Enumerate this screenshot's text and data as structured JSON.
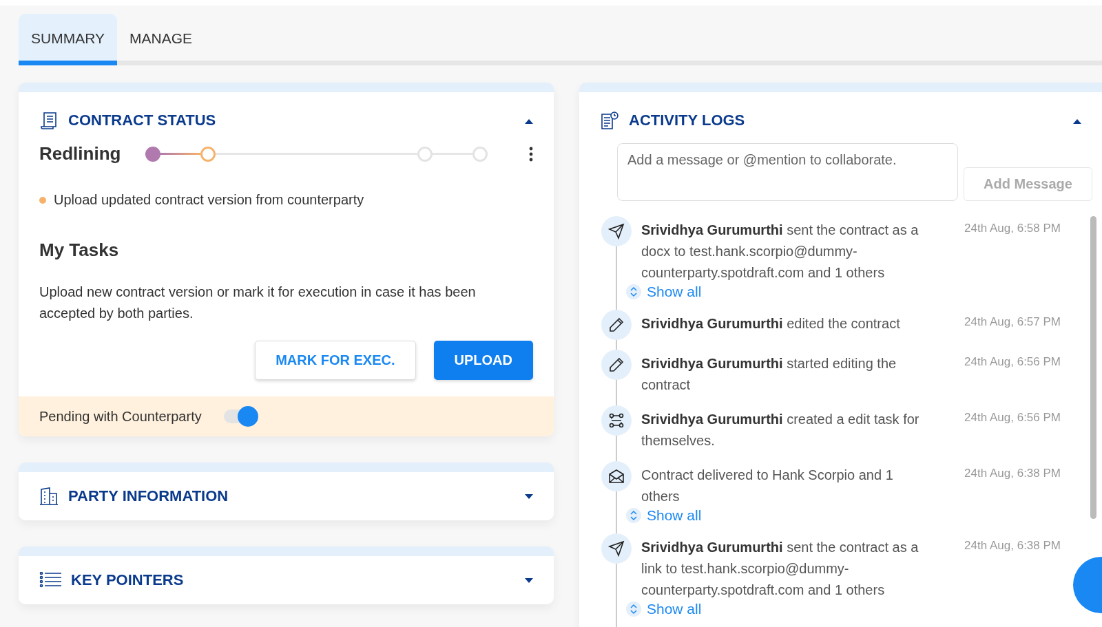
{
  "tabs": [
    {
      "label": "SUMMARY",
      "selected": true
    },
    {
      "label": "MANAGE",
      "selected": false
    }
  ],
  "contract_status": {
    "title": "CONTRACT STATUS",
    "expanded": true,
    "stage": "Redlining",
    "steps": [
      {
        "kind": "done"
      },
      {
        "kind": "current"
      },
      {
        "kind": "pending"
      },
      {
        "kind": "pending"
      }
    ],
    "next_action": "Upload updated contract version from counterparty",
    "tasks_title": "My Tasks",
    "tasks_text": "Upload new contract version or mark it for execution in case it has been accepted by both parties.",
    "buttons": [
      {
        "label": "MARK FOR EXEC.",
        "kind": "secondary"
      },
      {
        "label": "UPLOAD",
        "kind": "primary"
      }
    ],
    "pending": {
      "label": "Pending with Counterparty",
      "on": true
    }
  },
  "sections": [
    {
      "title": "PARTY INFORMATION",
      "kind": "building",
      "expanded": false
    },
    {
      "title": "KEY POINTERS",
      "kind": "list",
      "expanded": false
    }
  ],
  "activity_logs": {
    "title": "ACTIVITY LOGS",
    "expanded": true,
    "message": {
      "placeholder": "Add a message or @mention to collaborate."
    },
    "add_button": "Add Message",
    "entries": [
      {
        "kind": "send",
        "text": "**Srividhya Gurumurthi** sent the contract as a docx to test.hank.scorpio@dummy-counterparty.spotdraft.com and 1 others",
        "time": "24th Aug, 6:58 PM",
        "show_all": "Show all"
      },
      {
        "kind": "edit",
        "text": "**Srividhya Gurumurthi** edited the contract",
        "time": "24th Aug, 6:57 PM"
      },
      {
        "kind": "edit",
        "text": "**Srividhya Gurumurthi** started editing the contract",
        "time": "24th Aug, 6:56 PM"
      },
      {
        "kind": "task",
        "text": "**Srividhya Gurumurthi** created a edit task for themselves.",
        "time": "24th Aug, 6:56 PM"
      },
      {
        "kind": "mail",
        "text": "Contract delivered to Hank Scorpio and 1 others",
        "time": "24th Aug, 6:38 PM",
        "show_all": "Show all"
      },
      {
        "kind": "send",
        "text": "**Srividhya Gurumurthi** sent the contract as a link to test.hank.scorpio@dummy-counterparty.spotdraft.com and 1 others",
        "time": "24th Aug, 6:38 PM",
        "show_all": "Show all"
      }
    ]
  }
}
